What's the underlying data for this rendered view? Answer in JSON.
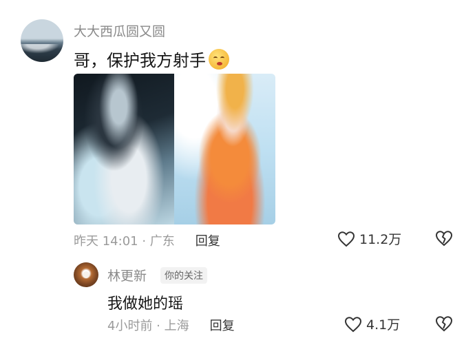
{
  "comment": {
    "username": "大大西瓜圆又圆",
    "text": "哥，保护我方射手",
    "emoji": "smirk-emoji",
    "time_location": "昨天 14:01 · 广东",
    "reply_label": "回复",
    "likes": "11.2万"
  },
  "reply": {
    "username": "林更新",
    "badge": "你的关注",
    "text": "我做她的瑶",
    "time_location": "4小时前 · 上海",
    "reply_label": "回复",
    "likes": "4.1万"
  },
  "icons": {
    "like": "heart-icon",
    "dislike": "broken-heart-icon"
  },
  "colors": {
    "text_primary": "#161616",
    "text_secondary": "#8a8a8a",
    "badge_bg": "#f2f2f2"
  }
}
